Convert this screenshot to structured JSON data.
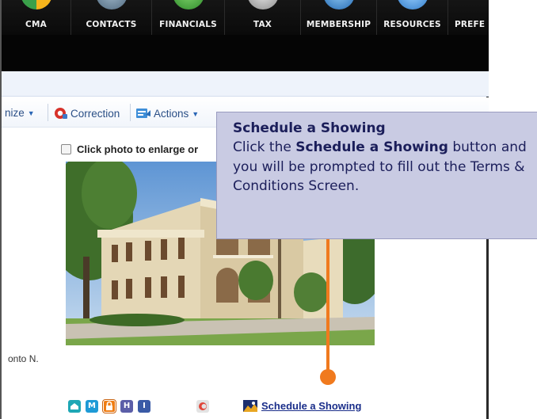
{
  "nav": {
    "items": [
      {
        "label": "CMA",
        "icon": "cma-icon"
      },
      {
        "label": "CONTACTS",
        "icon": "contacts-icon"
      },
      {
        "label": "FINANCIALS",
        "icon": "financials-icon"
      },
      {
        "label": "TAX",
        "icon": "tax-icon"
      },
      {
        "label": "MEMBERSHIP",
        "icon": "membership-icon"
      },
      {
        "label": "RESOURCES",
        "icon": "resources-icon"
      },
      {
        "label": "PREFE",
        "icon": "preferences-icon"
      }
    ]
  },
  "toolbar": {
    "customize_label": "nize",
    "correction_label": "Correction",
    "actions_label": "Actions"
  },
  "listing": {
    "photo_option_label": "Click photo to enlarge or",
    "address_fragment": "onto N.",
    "photo_alt": "listing-photo"
  },
  "links": {
    "icons": [
      {
        "letter": "",
        "name": "home-icon",
        "color": "#1ea7b5"
      },
      {
        "letter": "M",
        "name": "map-icon",
        "color": "#1e9ad6"
      },
      {
        "letter": "",
        "name": "lock-icon",
        "color": "#ef7d14"
      },
      {
        "letter": "H",
        "name": "history-icon",
        "color": "#5b5ea8"
      },
      {
        "letter": "I",
        "name": "info-icon",
        "color": "#3a5aa6"
      },
      {
        "letter": "",
        "name": "cloud-cma-icon",
        "color": "#d9d9d9"
      }
    ],
    "schedule_label": "Schedule a Showing"
  },
  "callout": {
    "title": "Schedule a Showing",
    "body_pre": "Click the ",
    "body_bold": "Schedule a Showing",
    "body_post": " button and you will be prompted to fill out the Terms & Conditions Screen."
  },
  "colors": {
    "accent_orange": "#f07a1e",
    "callout_bg": "#c9cbe3",
    "callout_text": "#1b1e5a",
    "link_blue": "#1a2e8a"
  }
}
